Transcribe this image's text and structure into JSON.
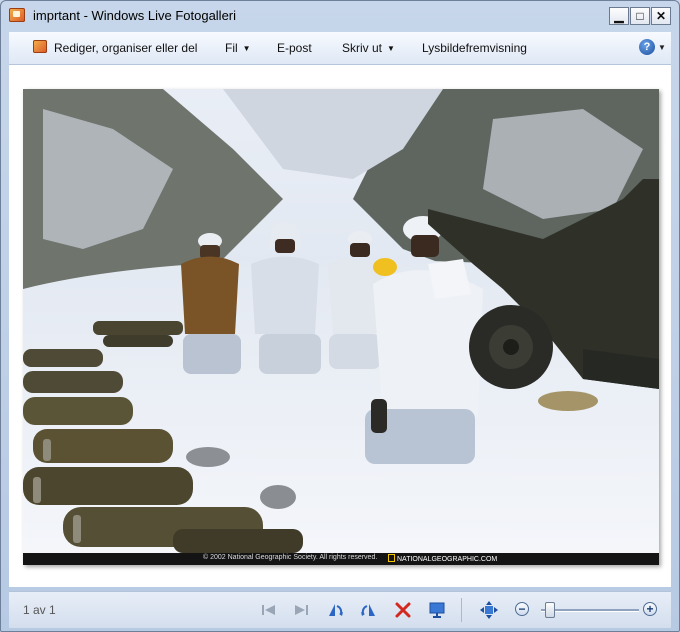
{
  "window": {
    "title": "imprtant - Windows Live Fotogalleri"
  },
  "caption_buttons": {
    "minimize": "▁",
    "maximize": "□",
    "close": "✕"
  },
  "menu": {
    "organize_label": "Rediger, organiser eller del",
    "items": [
      {
        "label": "Fil",
        "has_caret": true
      },
      {
        "label": "E-post",
        "has_caret": false
      },
      {
        "label": "Skriv ut",
        "has_caret": true
      },
      {
        "label": "Lysbildefremvisning",
        "has_caret": false
      }
    ],
    "help_glyph": "?"
  },
  "photo": {
    "description_icon": "photo-preview",
    "credit": "© 2002 National Geographic Society. All rights reserved.",
    "brand": "NATIONALGEOGRAPHIC.COM"
  },
  "status": {
    "counter": "1 av 1",
    "zoom_level": 0.04
  },
  "toolbar_icons": [
    "previous-icon",
    "next-icon",
    "rotate-left-icon",
    "rotate-right-icon",
    "delete-icon",
    "slideshow-icon",
    "actual-size-icon"
  ],
  "colors": {
    "accent": "#1d4f9c",
    "delete": "#d3281f"
  }
}
